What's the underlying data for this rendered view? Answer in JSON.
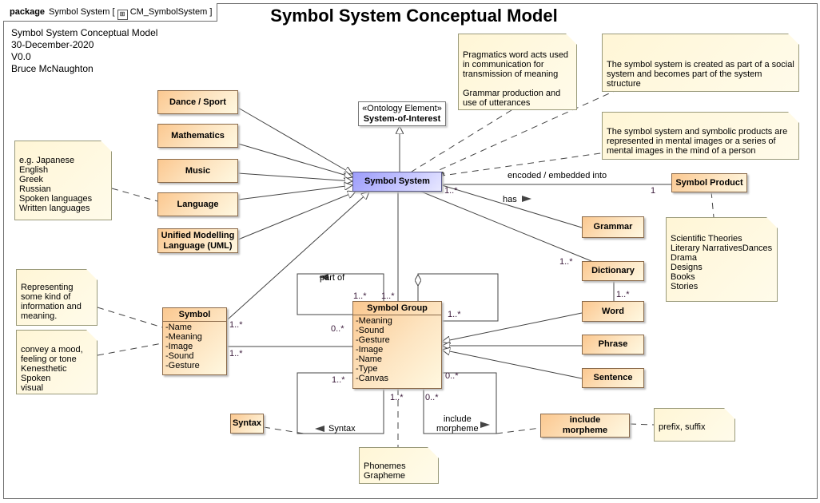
{
  "package": {
    "keyword": "package",
    "name": "Symbol System",
    "diagram": "CM_SymbolSystem",
    "diagram_icon": "diagram-icon"
  },
  "title": "Symbol System Conceptual Model",
  "info": [
    "Symbol System Conceptual Model",
    "30-December-2020",
    "V0.0",
    "Bruce McNaughton"
  ],
  "classes": {
    "dance": "Dance / Sport",
    "math": "Mathematics",
    "music": "Music",
    "language": "Language",
    "uml": "Unified Modelling Language (UML)",
    "system": "Symbol System",
    "product": "Symbol Product",
    "grammar": "Grammar",
    "dictionary": "Dictionary",
    "word": "Word",
    "phrase": "Phrase",
    "sentence": "Sentence",
    "syntax": "Syntax",
    "morpheme": "include morpheme"
  },
  "ontology": {
    "stereotype": "«Ontology Element»",
    "name": "System-of-Interest"
  },
  "symbol": {
    "name": "Symbol",
    "attributes": [
      "-Name",
      "-Meaning",
      "-Image",
      "-Sound",
      "-Gesture"
    ]
  },
  "symbol_group": {
    "name": "Symbol Group",
    "attributes": [
      "-Meaning",
      "-Sound",
      "-Gesture",
      "-Image",
      "-Name",
      "-Type",
      "-Canvas"
    ]
  },
  "notes": {
    "pragmatics": "Pragmatics word acts used in communication for transmission of meaning\n\nGrammar production and use of utterances",
    "social": "The symbol system is created as part of a social system and becomes part of the system structure",
    "mental": "The symbol system and symbolic products are represented in mental images or a series of mental images in the mind of a person",
    "languages": "e.g. Japanese\nEnglish\nGreek\nRussian\nSpoken languages\nWritten languages",
    "representing": "Representing some kind of information and meaning.",
    "mood": "convey a mood, feeling or tone\nKenesthetic\nSpoken\nvisual",
    "products": "\nScientific Theories\nLiterary NarrativesDances\nDrama\nDesigns\nBooks\nStories",
    "phonemes": "Phonemes\nGrapheme",
    "prefix": "prefix, suffix"
  },
  "labels": {
    "encoded": "encoded / embedded into",
    "has": "has",
    "part_of": "part of",
    "syntax": "Syntax",
    "include": "include\nmorpheme"
  },
  "multiplicities": {
    "sys_product": "1..*",
    "product": "1",
    "dict": "1..*",
    "word": "1..*",
    "sym_sys": "1..*",
    "sym_grp": "1..*",
    "grp_part1": "1..*",
    "grp_part2": "1..*",
    "grp_part0": "0..*",
    "grp_self": "1..*",
    "syn1": "1..*",
    "syn2": "1..*",
    "inc1": "0..*",
    "inc2": "0..*"
  },
  "colors": {
    "class_fill": "#fde5c2",
    "system_fill": "#c8c8ff",
    "note_fill": "#fff6d6"
  }
}
